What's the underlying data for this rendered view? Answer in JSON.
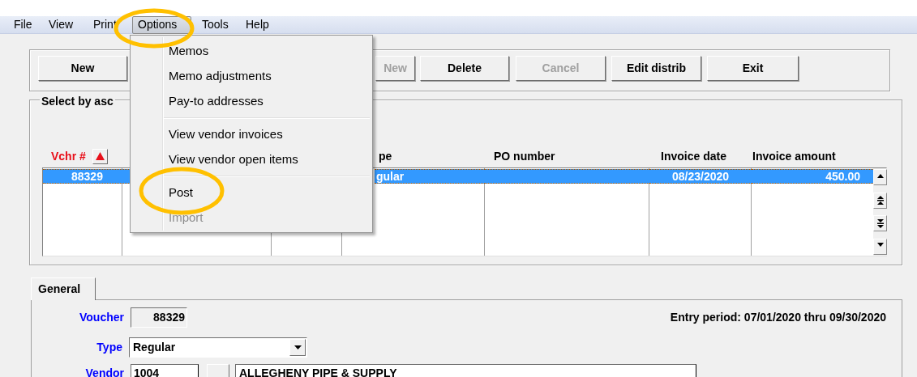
{
  "menu_bar": [
    {
      "label": "File",
      "selected": false
    },
    {
      "label": "View",
      "selected": false
    },
    {
      "label": "Print",
      "selected": false
    },
    {
      "label": "Options",
      "selected": true
    },
    {
      "label": "Tools",
      "selected": false
    },
    {
      "label": "Help",
      "selected": false
    }
  ],
  "toolbar": {
    "buttons": [
      {
        "label": "New",
        "disabled": false
      },
      {
        "label": "New",
        "disabled": true
      },
      {
        "label": "Delete",
        "disabled": false
      },
      {
        "label": "Cancel",
        "disabled": true
      },
      {
        "label": "Edit distrib",
        "disabled": false
      },
      {
        "label": "Exit",
        "disabled": false
      }
    ]
  },
  "select_group": {
    "title": "Select by asc",
    "columns": [
      {
        "label": "Vchr #",
        "sorted": true
      },
      {},
      {},
      {
        "label": "pe",
        "sorted": false
      },
      {
        "label": "PO number",
        "sorted": false
      },
      {
        "label": "Invoice date",
        "sorted": false
      },
      {
        "label": "Invoice amount",
        "sorted": false
      }
    ],
    "rows": [
      {
        "selected": true,
        "vchr": "88329",
        "column_4": "gular",
        "invoice_date": "08/23/2020",
        "invoice_amount": "450.00"
      }
    ]
  },
  "options_menu": {
    "items": [
      {
        "kind": "item",
        "label": "Memos",
        "disabled": false
      },
      {
        "kind": "item",
        "label": "Memo adjustments",
        "disabled": false
      },
      {
        "kind": "item",
        "label": "Pay-to addresses",
        "disabled": false
      },
      {
        "kind": "separator"
      },
      {
        "kind": "item",
        "label": "View vendor invoices",
        "disabled": false
      },
      {
        "kind": "item",
        "label": "View vendor open items",
        "disabled": false
      },
      {
        "kind": "separator"
      },
      {
        "kind": "item",
        "label": "Post",
        "disabled": false
      },
      {
        "kind": "item",
        "label": "Import",
        "disabled": true
      }
    ]
  },
  "tabs": [
    {
      "label": "General",
      "selected": true
    }
  ],
  "general": {
    "voucher": {
      "label": "Voucher",
      "value": "88329"
    },
    "entry_period": "Entry period: 07/01/2020 thru 09/30/2020",
    "type": {
      "label": "Type",
      "value": "Regular"
    },
    "vendor": {
      "label": "Vendor",
      "value": "1004",
      "name": "ALLEGHENY PIPE & SUPPLY"
    }
  },
  "highlights": [
    {
      "kind": "ellipse"
    },
    {
      "kind": "ellipse"
    }
  ]
}
